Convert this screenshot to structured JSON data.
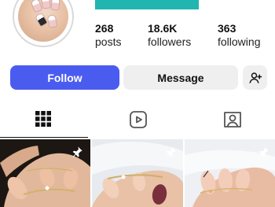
{
  "profile": {
    "stats": [
      {
        "value": "268",
        "label": "posts"
      },
      {
        "value": "18.6K",
        "label": "followers"
      },
      {
        "value": "363",
        "label": "following"
      }
    ]
  },
  "actions": {
    "follow_label": "Follow",
    "message_label": "Message",
    "add_icon": "add-person-icon"
  },
  "tabs": [
    {
      "icon": "grid-icon",
      "active": true
    },
    {
      "icon": "reels-icon",
      "active": false
    },
    {
      "icon": "tagged-icon",
      "active": false
    }
  ],
  "colors": {
    "follow_button": "#4a5cf0",
    "secondary_button": "#efefef",
    "accent_bar": "#21b5b0"
  },
  "posts": [
    {
      "pinned": true,
      "icon": "pin-icon"
    },
    {
      "pinned": true,
      "icon": "pin-icon"
    },
    {
      "pinned": true,
      "icon": "pin-icon"
    }
  ]
}
